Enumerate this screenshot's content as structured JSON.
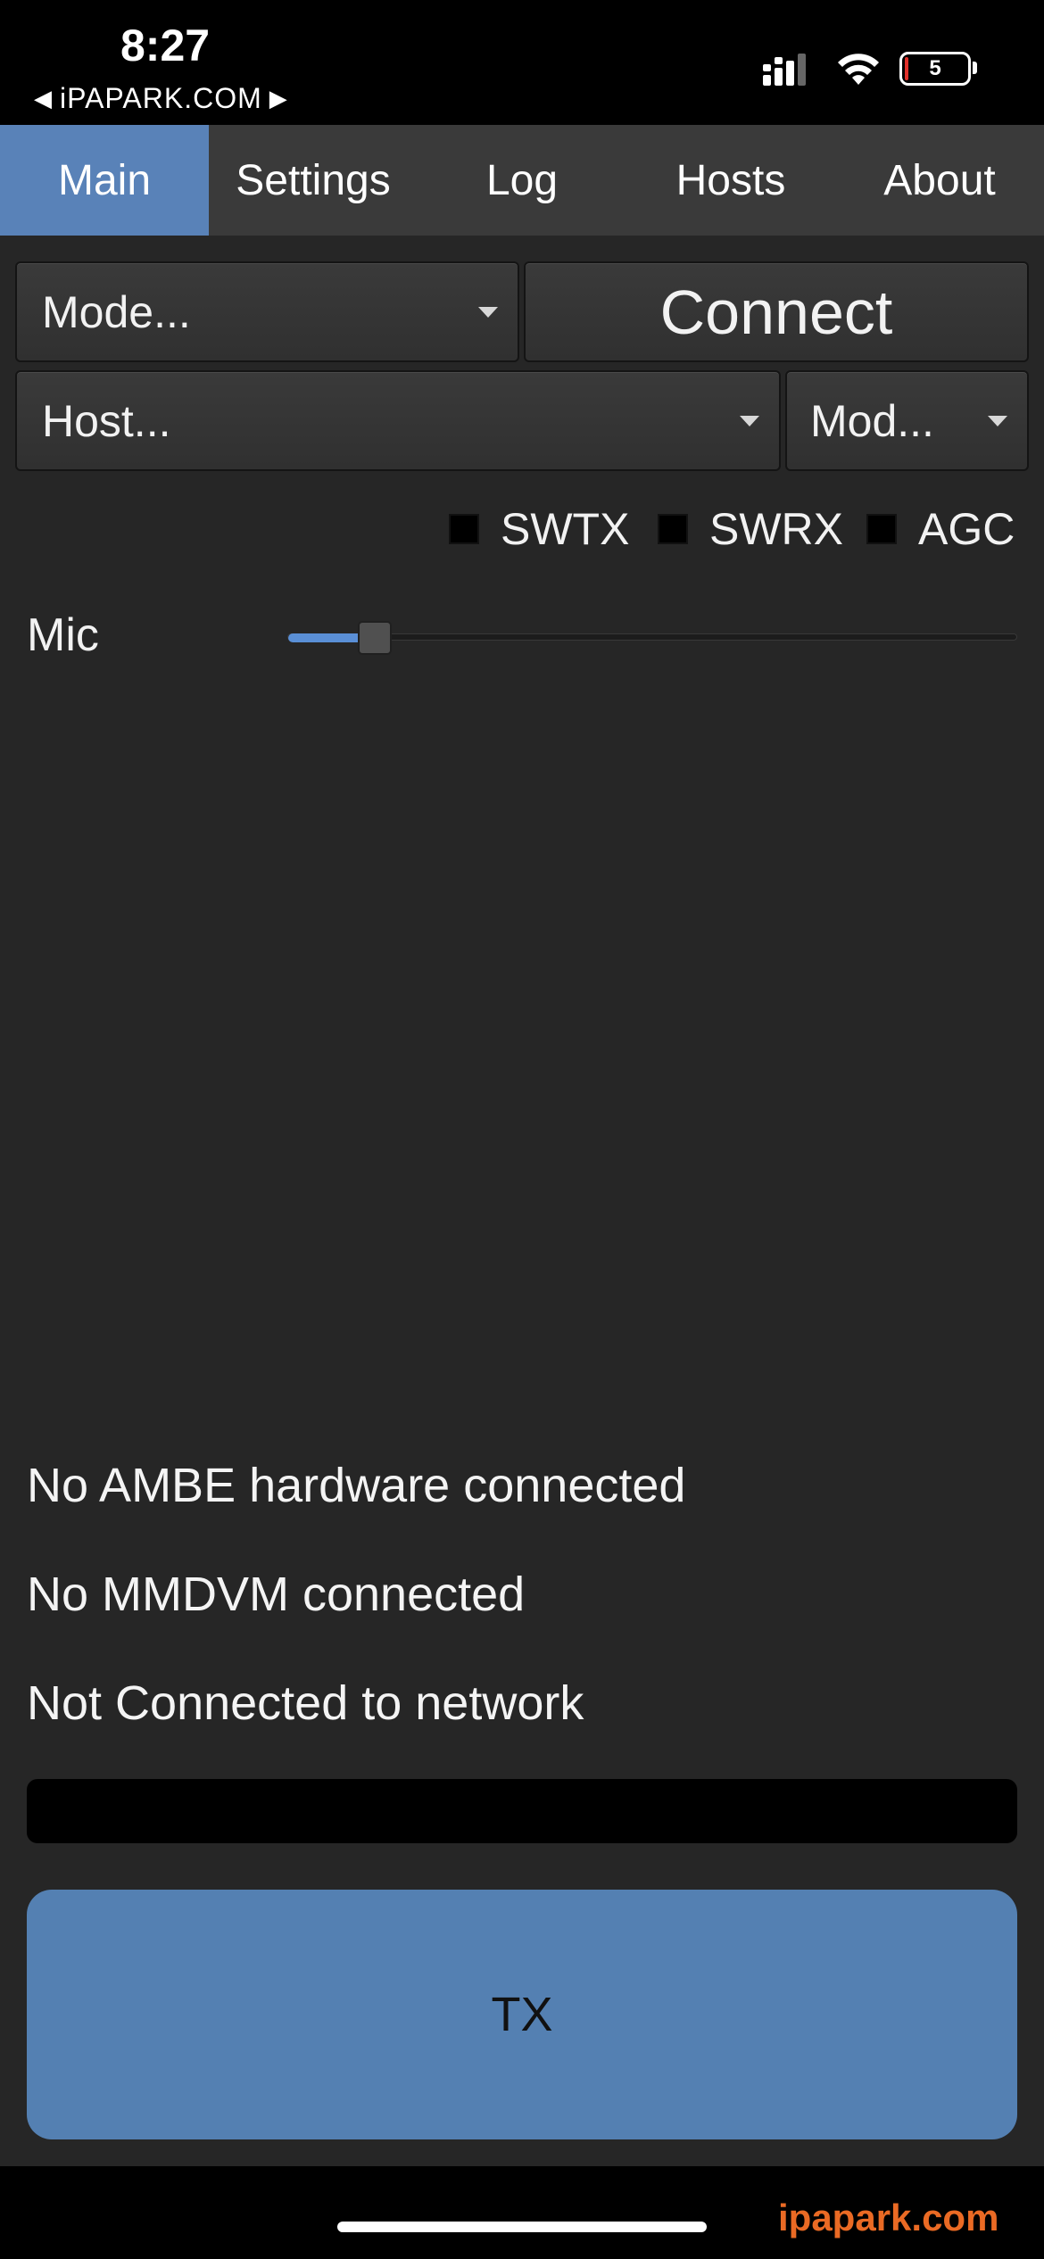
{
  "status_bar": {
    "time": "8:27",
    "back_app": "iPAPARK.COM",
    "battery_level": "5",
    "battery_low_color": "#e0302a"
  },
  "tabs": [
    {
      "label": "Main",
      "active": true
    },
    {
      "label": "Settings",
      "active": false
    },
    {
      "label": "Log",
      "active": false
    },
    {
      "label": "Hosts",
      "active": false
    },
    {
      "label": "About",
      "active": false
    }
  ],
  "main": {
    "mode_select": "Mode...",
    "connect_button": "Connect",
    "host_select": "Host...",
    "module_select": "Mod...",
    "checkboxes": [
      {
        "label": "SWTX",
        "checked": false
      },
      {
        "label": "SWRX",
        "checked": false
      },
      {
        "label": "AGC",
        "checked": false
      }
    ],
    "mic_label": "Mic",
    "mic_level": 0.12,
    "status_lines": [
      "No AMBE hardware connected",
      "No MMDVM connected",
      "Not Connected to network"
    ],
    "tx_button": "TX"
  },
  "watermark": "ipapark.com",
  "colors": {
    "accent": "#5982b8",
    "tx_button": "#5480b2",
    "background": "#262626",
    "watermark": "#ea6a24"
  }
}
